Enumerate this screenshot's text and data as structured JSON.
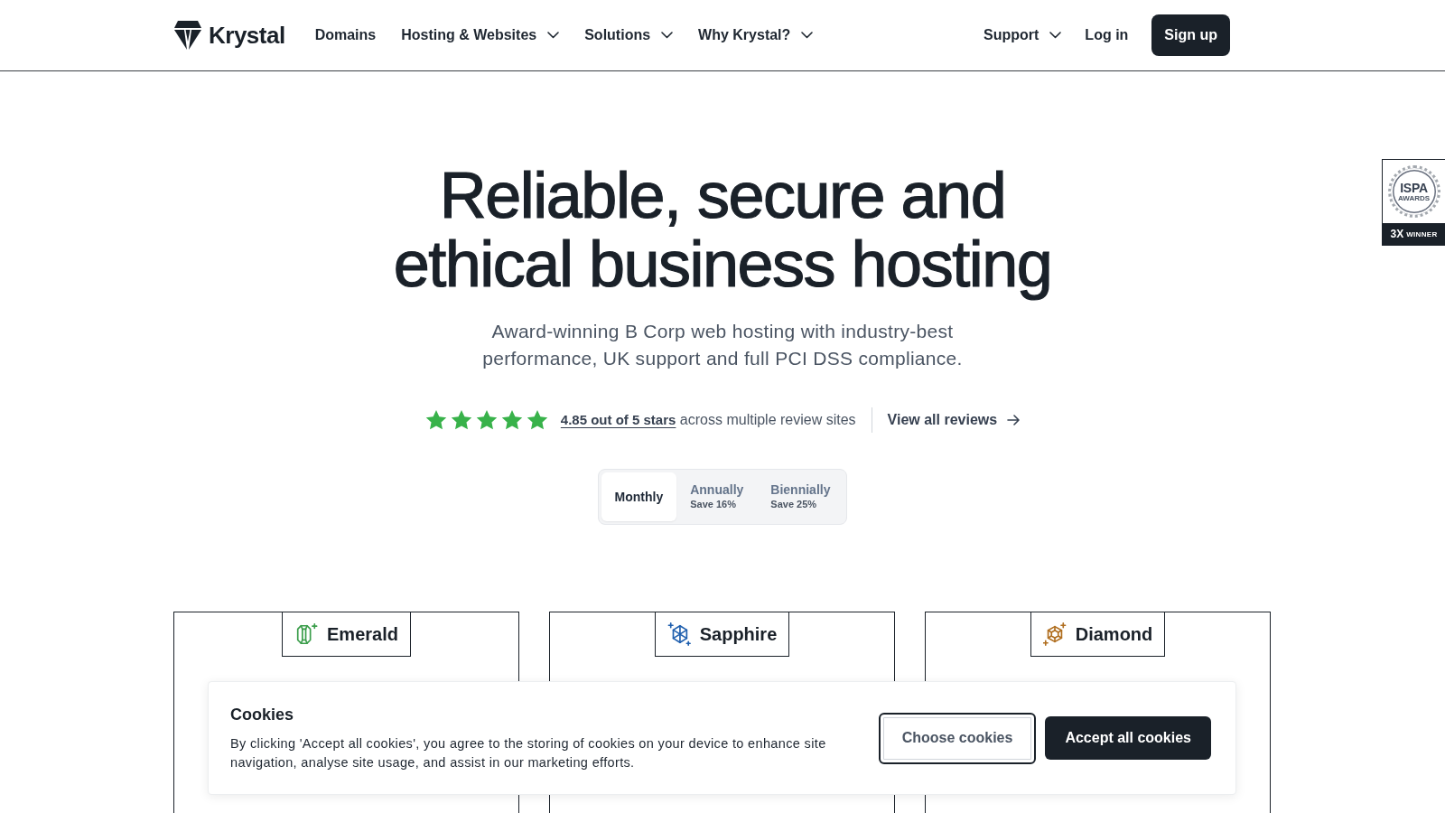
{
  "nav": {
    "logo": "Krystal",
    "items": [
      {
        "label": "Domains",
        "dropdown": false
      },
      {
        "label": "Hosting & Websites",
        "dropdown": true
      },
      {
        "label": "Solutions",
        "dropdown": true
      },
      {
        "label": "Why Krystal?",
        "dropdown": true
      }
    ],
    "right_items": [
      {
        "label": "Support",
        "dropdown": true
      },
      {
        "label": "Log in",
        "dropdown": false
      }
    ],
    "signup": "Sign up"
  },
  "hero": {
    "title": "Reliable, secure and ethical business hosting",
    "subtitle": "Award-winning B Corp web hosting with industry-best performance, UK support and full PCI DSS compliance."
  },
  "rating": {
    "stars": 5,
    "score": "4.85 out of 5 stars",
    "note": "across multiple review sites",
    "link": "View all reviews"
  },
  "billing": [
    {
      "label": "Monthly",
      "selected": true
    },
    {
      "label": "Annually",
      "saving": "Save 16%",
      "selected": false
    },
    {
      "label": "Biennially",
      "saving": "Save 25%",
      "selected": false
    }
  ],
  "award": {
    "title": "ISPA",
    "subtitle": "AWARDS",
    "ribbon_count": "3X",
    "ribbon_text": "WINNER"
  },
  "plans": [
    {
      "name": "Emerald",
      "kind": "emerald"
    },
    {
      "name": "Sapphire",
      "kind": "sapphire"
    },
    {
      "name": "Diamond",
      "kind": "diamond"
    }
  ],
  "cookie_banner": {
    "title": "Cookies",
    "text": "By clicking 'Accept all cookies', you agree to the storing of cookies on your device to enhance site navigation, analyse site usage, and assist in our marketing efforts.",
    "buttons": [
      {
        "label": "Choose cookies",
        "kind": "secondary"
      },
      {
        "label": "Accept all cookies",
        "kind": "primary"
      }
    ]
  }
}
